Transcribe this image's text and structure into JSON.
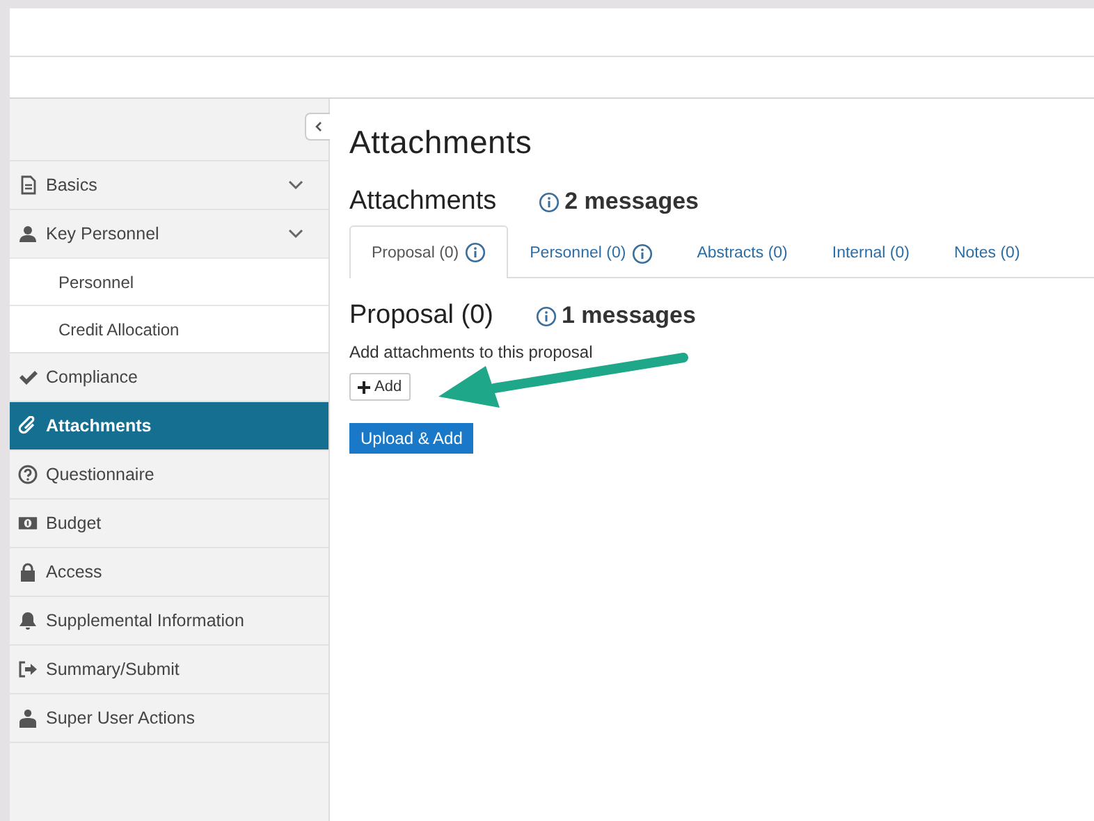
{
  "sidebar": {
    "items": [
      {
        "label": "Basics",
        "expandable": true,
        "selected": false
      },
      {
        "label": "Key Personnel",
        "expandable": true,
        "selected": false,
        "children": [
          {
            "label": "Personnel",
            "selected": false
          },
          {
            "label": "Credit Allocation",
            "selected": false
          }
        ]
      },
      {
        "label": "Compliance",
        "expandable": false,
        "selected": false
      },
      {
        "label": "Attachments",
        "expandable": false,
        "selected": true
      },
      {
        "label": "Questionnaire",
        "expandable": false,
        "selected": false
      },
      {
        "label": "Budget",
        "expandable": false,
        "selected": false
      },
      {
        "label": "Access",
        "expandable": false,
        "selected": false
      },
      {
        "label": "Supplemental Information",
        "expandable": false,
        "selected": false
      },
      {
        "label": "Summary/Submit",
        "expandable": false,
        "selected": false
      },
      {
        "label": "Super User Actions",
        "expandable": false,
        "selected": false
      }
    ]
  },
  "page_title": "Attachments",
  "section": {
    "title": "Attachments",
    "messages": "2 messages"
  },
  "tabs": [
    {
      "label": "Proposal (0)",
      "info": true,
      "selected": true
    },
    {
      "label": "Personnel (0)",
      "info": true,
      "selected": false
    },
    {
      "label": "Abstracts (0)",
      "info": false,
      "selected": false
    },
    {
      "label": "Internal (0)",
      "info": false,
      "selected": false
    },
    {
      "label": "Notes (0)",
      "info": false,
      "selected": false
    }
  ],
  "panel": {
    "title": "Proposal (0)",
    "messages": "1 messages",
    "description": "Add attachments to this proposal",
    "add_button": "Add",
    "upload_button": "Upload & Add"
  }
}
